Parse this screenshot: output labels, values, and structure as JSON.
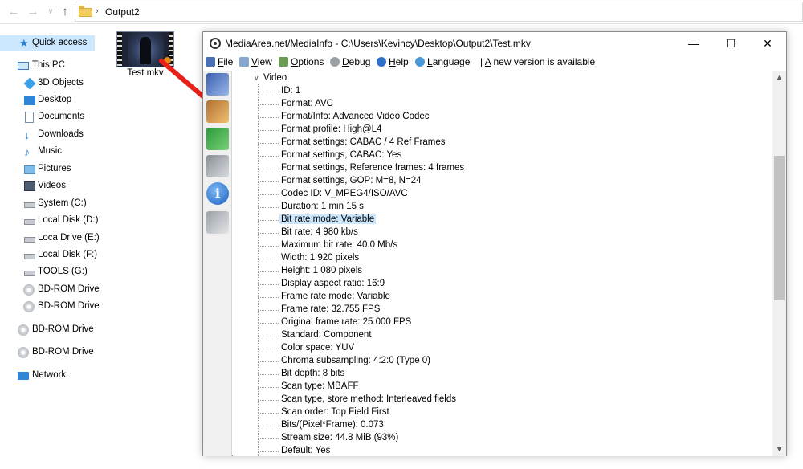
{
  "explorer": {
    "nav": {
      "back": "←",
      "forward": "→",
      "down": "∨",
      "up": "↑"
    },
    "address": {
      "separator": "›",
      "path": "Output2"
    },
    "sidebar": [
      {
        "label": "Quick access",
        "icon": "star-icon",
        "selected": true
      },
      {
        "label": "This PC",
        "icon": "computer-icon"
      },
      {
        "label": "3D Objects",
        "icon": "cube-icon"
      },
      {
        "label": "Desktop",
        "icon": "desktop-icon"
      },
      {
        "label": "Documents",
        "icon": "document-icon"
      },
      {
        "label": "Downloads",
        "icon": "download-icon"
      },
      {
        "label": "Music",
        "icon": "music-icon"
      },
      {
        "label": "Pictures",
        "icon": "picture-icon"
      },
      {
        "label": "Videos",
        "icon": "video-icon"
      },
      {
        "label": "System (C:)",
        "icon": "drive-icon"
      },
      {
        "label": "Local Disk (D:)",
        "icon": "drive-icon"
      },
      {
        "label": "Loca Drive (E:)",
        "icon": "drive-icon"
      },
      {
        "label": "Local Disk (F:)",
        "icon": "drive-icon"
      },
      {
        "label": "TOOLS (G:)",
        "icon": "drive-icon"
      },
      {
        "label": "BD-ROM Drive",
        "icon": "disc-icon"
      },
      {
        "label": "BD-ROM Drive",
        "icon": "disc-icon"
      },
      {
        "label": "BD-ROM Drive (H",
        "icon": "disc-icon"
      },
      {
        "label": "BD-ROM Drive (I",
        "icon": "disc-icon"
      },
      {
        "label": "Network",
        "icon": "network-icon"
      }
    ],
    "file": {
      "name": "Test.mkv",
      "icon": "video-file-thumbnail"
    }
  },
  "mediainfo": {
    "title": "MediaArea.net/MediaInfo - C:\\Users\\Kevincy\\Desktop\\Output2\\Test.mkv",
    "window_buttons": {
      "minimize": "—",
      "maximize": "☐",
      "close": "✕"
    },
    "menu": [
      {
        "key": "F",
        "rest": "ile",
        "icon": "file-icon"
      },
      {
        "key": "V",
        "rest": "iew",
        "icon": "view-icon"
      },
      {
        "key": "O",
        "rest": "ptions",
        "icon": "options-icon"
      },
      {
        "key": "D",
        "rest": "ebug",
        "icon": "debug-icon"
      },
      {
        "key": "H",
        "rest": "elp",
        "icon": "help-icon"
      },
      {
        "key": "L",
        "rest": "anguage",
        "icon": "language-icon"
      }
    ],
    "news": {
      "bar": "|",
      "key": "A",
      "rest": " new version is available"
    },
    "toolbar_info_glyph": "i",
    "tree": {
      "caret": "∨",
      "root": "Video",
      "rows": [
        "ID: 1",
        "Format: AVC",
        "Format/Info: Advanced Video Codec",
        "Format profile: High@L4",
        "Format settings: CABAC / 4 Ref Frames",
        "Format settings, CABAC: Yes",
        "Format settings, Reference frames: 4 frames",
        "Format settings, GOP: M=8, N=24",
        "Codec ID: V_MPEG4/ISO/AVC",
        "Duration: 1 min 15 s",
        "Bit rate mode: Variable",
        "Bit rate: 4 980 kb/s",
        "Maximum bit rate: 40.0 Mb/s",
        "Width: 1 920 pixels",
        "Height: 1 080 pixels",
        "Display aspect ratio: 16:9",
        "Frame rate mode: Variable",
        "Frame rate: 32.755 FPS",
        "Original frame rate: 25.000 FPS",
        "Standard: Component",
        "Color space: YUV",
        "Chroma subsampling: 4:2:0 (Type 0)",
        "Bit depth: 8 bits",
        "Scan type: MBAFF",
        "Scan type, store method: Interleaved fields",
        "Scan order: Top Field First",
        "Bits/(Pixel*Frame): 0.073",
        "Stream size: 44.8 MiB (93%)",
        "Default: Yes"
      ],
      "selected_row": "Bit rate mode: Variable"
    },
    "scrollbar": {
      "up": "▲",
      "down": "▼"
    }
  },
  "colors": {
    "selection": "#cce8ff",
    "arrow": "#e8201a",
    "folder": "#f4cd63"
  }
}
